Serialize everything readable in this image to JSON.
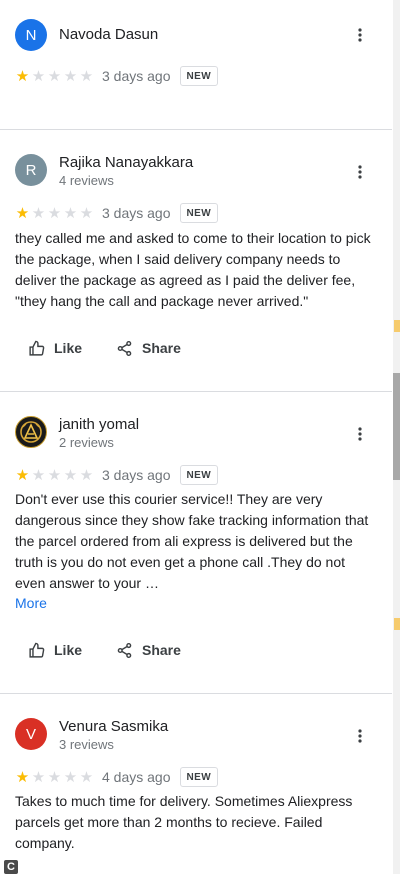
{
  "colors": {
    "star_on": "#fbbc04",
    "star_off": "#dadce0",
    "link": "#1a73e8",
    "badge_border": "#dadce0"
  },
  "actions": {
    "like_label": "Like",
    "share_label": "Share",
    "more_label": "More"
  },
  "reviews": [
    {
      "initial": "N",
      "avatar_color": "#1a73e8",
      "name": "Navoda Dasun",
      "reviews_count": "",
      "rating": 1,
      "time": "3 days ago",
      "badge": "NEW",
      "text": ""
    },
    {
      "initial": "R",
      "avatar_color": "#78909c",
      "name": "Rajika Nanayakkara",
      "reviews_count": "4 reviews",
      "rating": 1,
      "time": "3 days ago",
      "badge": "NEW",
      "text": "they called me and asked to come to their location to pick the package, when I said delivery company needs to deliver the package as agreed as I paid the deliver fee, \"they hang the call and package never arrived.\""
    },
    {
      "initial": "",
      "avatar_icon": "logo-emblem-icon",
      "name": "janith yomal",
      "reviews_count": "2 reviews",
      "rating": 1,
      "time": "3 days ago",
      "badge": "NEW",
      "text": "Don't ever use this courier service!! They are very dangerous since they show fake tracking information that the parcel ordered from ali express is delivered but the truth is you do not even get a phone call .They do not even answer to your …"
    },
    {
      "initial": "V",
      "avatar_color": "#d93025",
      "name": "Venura Sasmika",
      "reviews_count": "3 reviews",
      "rating": 1,
      "time": "4 days ago",
      "badge": "NEW",
      "text": "Takes to much time for delivery. Sometimes Aliexpress parcels get more than 2 months to recieve. Failed company."
    }
  ]
}
